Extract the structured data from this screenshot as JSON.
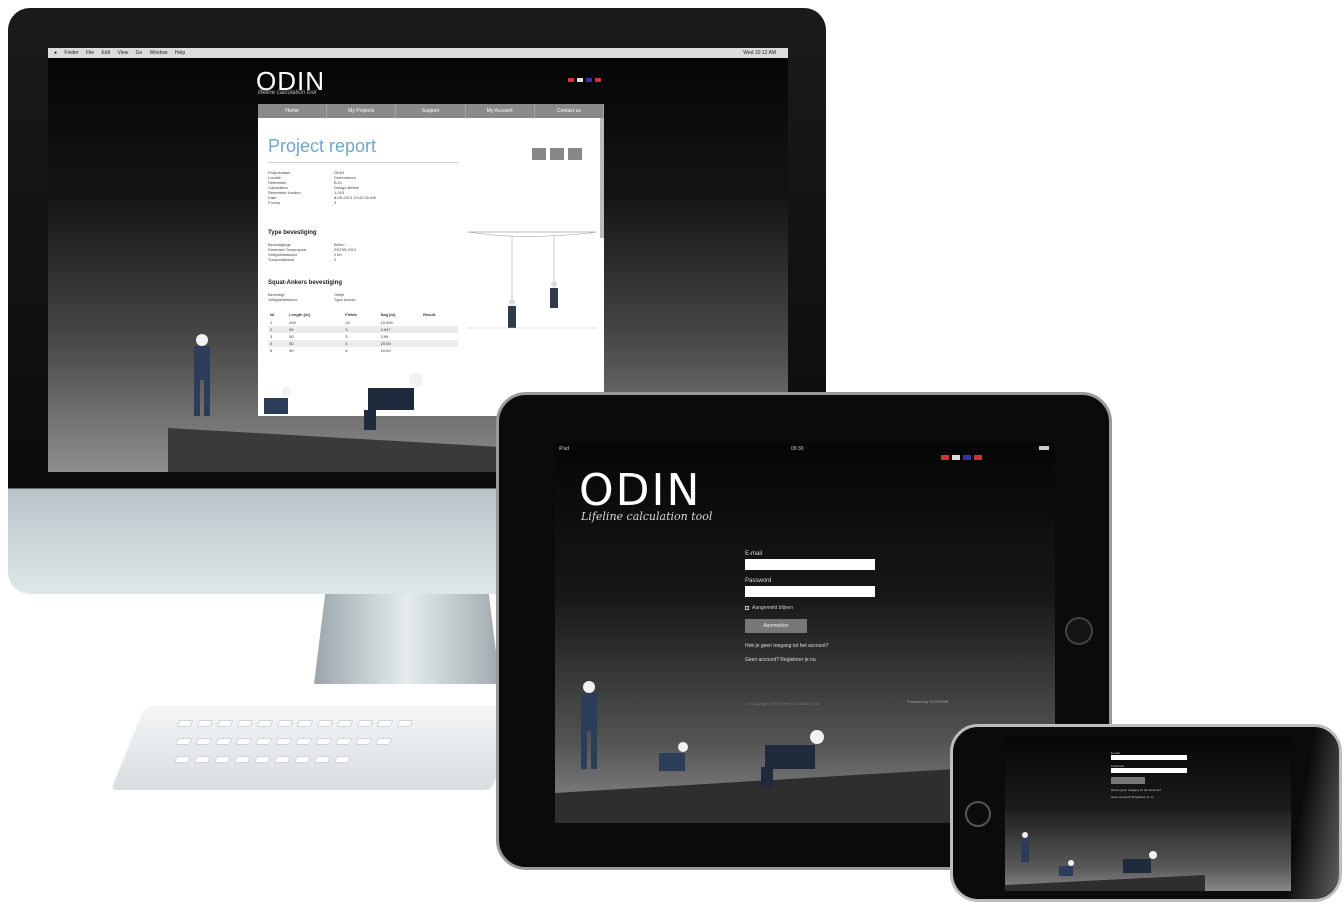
{
  "imac": {
    "menubar": {
      "items": [
        "Finder",
        "File",
        "Edit",
        "View",
        "Go",
        "Window",
        "Help"
      ],
      "right": "Wed 10:12 AM"
    },
    "logo": "ODIN",
    "tagline": "lifeline calculation tool",
    "colors": {
      "accent": "#6fa7c8",
      "nav": "#8a8a8a"
    },
    "nav": [
      "Home",
      "My Projects",
      "Support",
      "My Account",
      "Contact us"
    ],
    "report": {
      "title": "Project report",
      "details": [
        {
          "key": "Projectnaam",
          "value": "ODIN"
        },
        {
          "key": "Locatie",
          "value": "Dummmmm"
        },
        {
          "key": "Referentie",
          "value": "B.01"
        },
        {
          "key": "Calculation",
          "value": "Design lifeline"
        },
        {
          "key": "Referentie kunden",
          "value": "1.015"
        },
        {
          "key": "Date",
          "value": "8-05-2013 10:42:50 AM"
        },
        {
          "key": "Forces",
          "value": "3"
        }
      ],
      "section1": "Type bevestiging",
      "section1_rows": [
        {
          "key": "Bevestigings",
          "value": "Beton"
        },
        {
          "key": "Dimensie Tussenpost",
          "value": "EN795 2012"
        },
        {
          "key": "Veiligheidsfactor",
          "value": "2 kn"
        },
        {
          "key": "Tussenafstand",
          "value": "2"
        }
      ],
      "section2": "Squat-Ankers bevestiging",
      "section2_rows": [
        {
          "key": "Bevestigt",
          "value": "Gelijk"
        },
        {
          "key": "Veiligheidsfactor",
          "value": "Type kmnsd"
        }
      ],
      "table": {
        "headers": [
          "Nr",
          "Length [m]",
          "Fields",
          "Sag [m]",
          "Result"
        ],
        "rows": [
          [
            "1",
            "200",
            "10",
            "10.000",
            ""
          ],
          [
            "2",
            "50",
            "3",
            "3.547",
            ""
          ],
          [
            "3",
            "50",
            "3",
            "3.99",
            ""
          ],
          [
            "4",
            "50",
            "3",
            "20.00",
            ""
          ],
          [
            "5",
            "40",
            "4",
            "10.00",
            ""
          ]
        ]
      }
    }
  },
  "ipad": {
    "status": {
      "carrier": "iPad",
      "time": "09:30"
    },
    "logo": "ODIN",
    "tagline": "Lifeline calculation tool",
    "login": {
      "email_label": "E-mail",
      "password_label": "Password",
      "remember_label": "Aangemeld blijven",
      "submit_label": "Aanmelden",
      "forgot_link": "Heb je geen toegang tot het account?",
      "register_link": "Geen account? Registreer je nu"
    },
    "footer_left": "© Copyright ODIN lifeline calculation tool",
    "footer_right": "Powered by SYSTEMS"
  },
  "iphone": {
    "login": {
      "email_label": "E-mail",
      "password_label": "Password",
      "forgot_link": "Heb je geen toegang tot het account?",
      "register_link": "Geen account? Registreer je nu"
    }
  }
}
